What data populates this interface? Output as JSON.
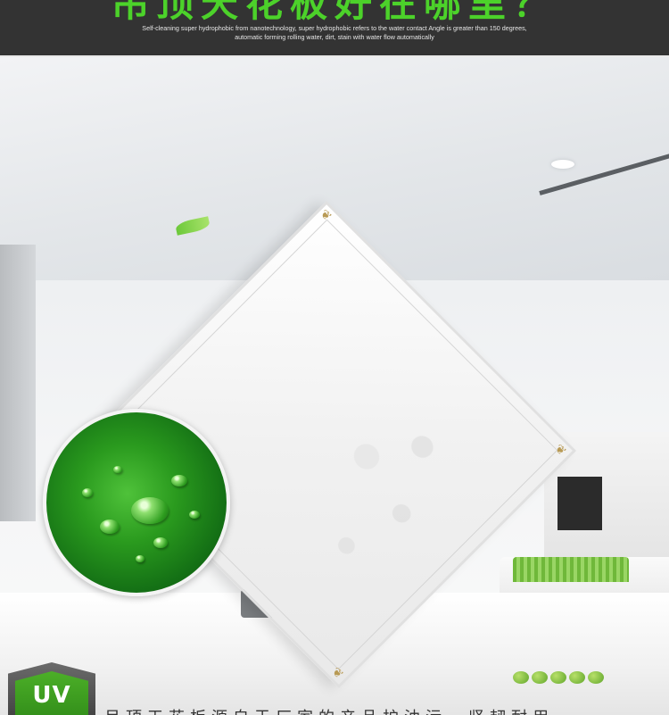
{
  "banner": {
    "title": "吊顶天花板好在哪里？",
    "subtitle": "Self-cleaning super hydrophobic from nanotechnology, super hydrophobic refers to the water contact Angle is greater than 150 degrees, automatic forming rolling water, dirt, stain with water flow automatically"
  },
  "badge": {
    "label": "UV"
  },
  "caption": {
    "text": "吊顶天花板源自于厂家的产品护油污，坚韧耐用"
  },
  "colors": {
    "banner_bg": "#333333",
    "title_green": "#4cd22a",
    "badge_green": "#3fa021"
  },
  "icons": [
    "leaf-icon",
    "corner-ornament-icon",
    "water-droplet-image"
  ]
}
